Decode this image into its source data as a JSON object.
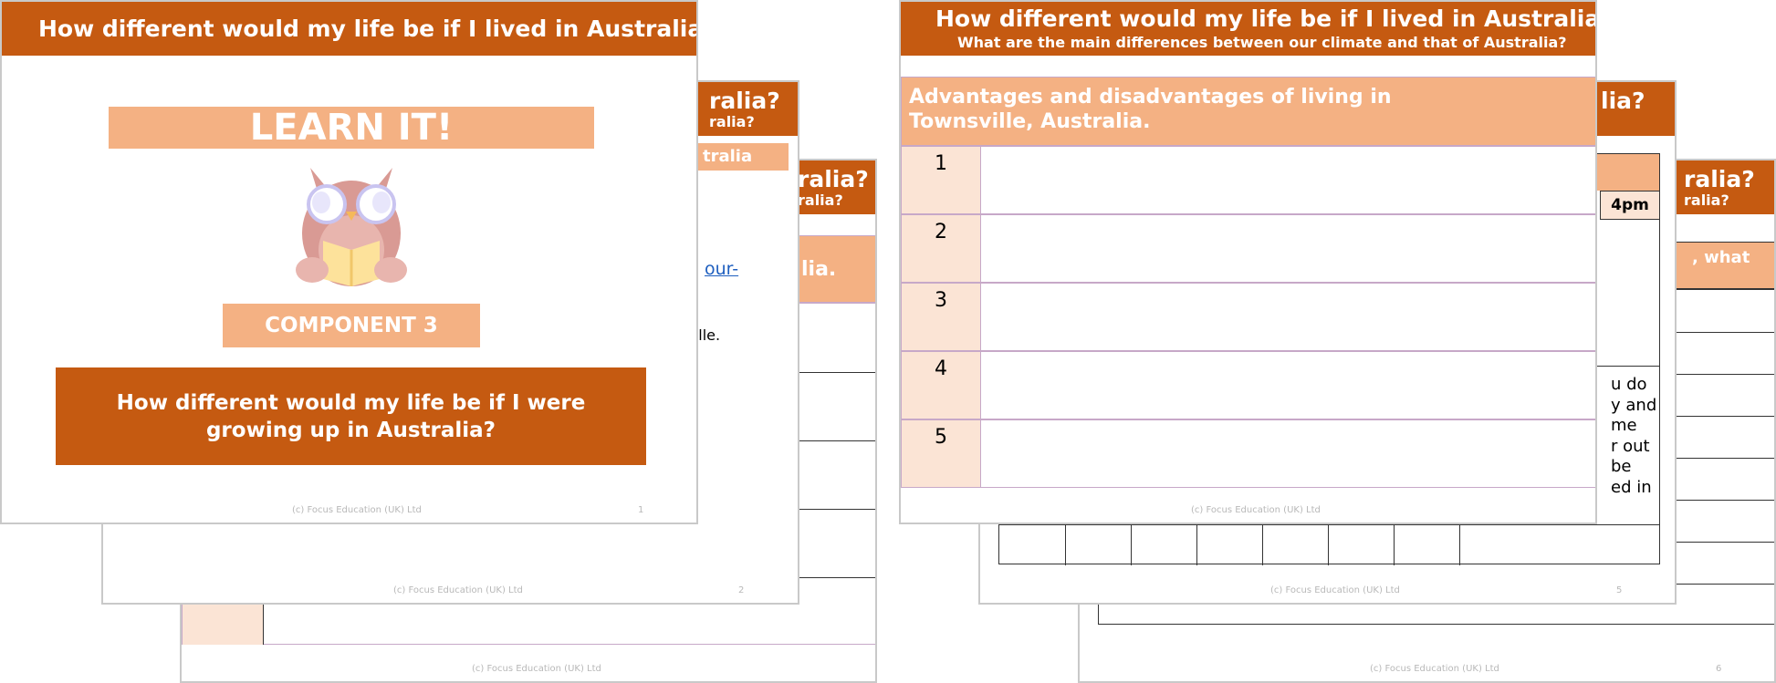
{
  "footer_text": "(c) Focus Education (UK) Ltd",
  "colors": {
    "header": "#c55a11",
    "accent": "#f4b183",
    "pale": "#fbe4d5"
  },
  "slide1": {
    "title": "How different would my life be if I lived in Australia?",
    "learn_label": "LEARN IT!",
    "component_label": "COMPONENT 3",
    "question": "How different would my life be if I were growing up in Australia?",
    "page": "1",
    "mascot_icon": "owl-reading-book-icon"
  },
  "slide2": {
    "title_frag": "ralia?",
    "subtitle_frag": "ralia?",
    "bar_frag": "tralia",
    "link_frag": "our-",
    "text_frag": "sville.",
    "page": "2"
  },
  "slide3": {
    "title_frag": "ralia?",
    "subtitle_frag": "ralia?",
    "bar_frag": "lia."
  },
  "slide4": {
    "title": "How different would my life be if I lived in Australia?",
    "subtitle": "What are the main differences between our climate and that of Australia?",
    "table_header": "Advantages and disadvantages of living in Townsville, Australia.",
    "rows": [
      "1",
      "2",
      "3",
      "4",
      "5"
    ]
  },
  "slide5": {
    "title_frag": "lia?",
    "time_label": "4pm",
    "text_lines": [
      "u do",
      "y and",
      "me",
      "r out",
      "be",
      "ed in"
    ],
    "page": "5"
  },
  "slide6": {
    "title_frag": "ralia?",
    "subtitle_frag": "ralia?",
    "bar_frag": ", what",
    "page": "6"
  }
}
